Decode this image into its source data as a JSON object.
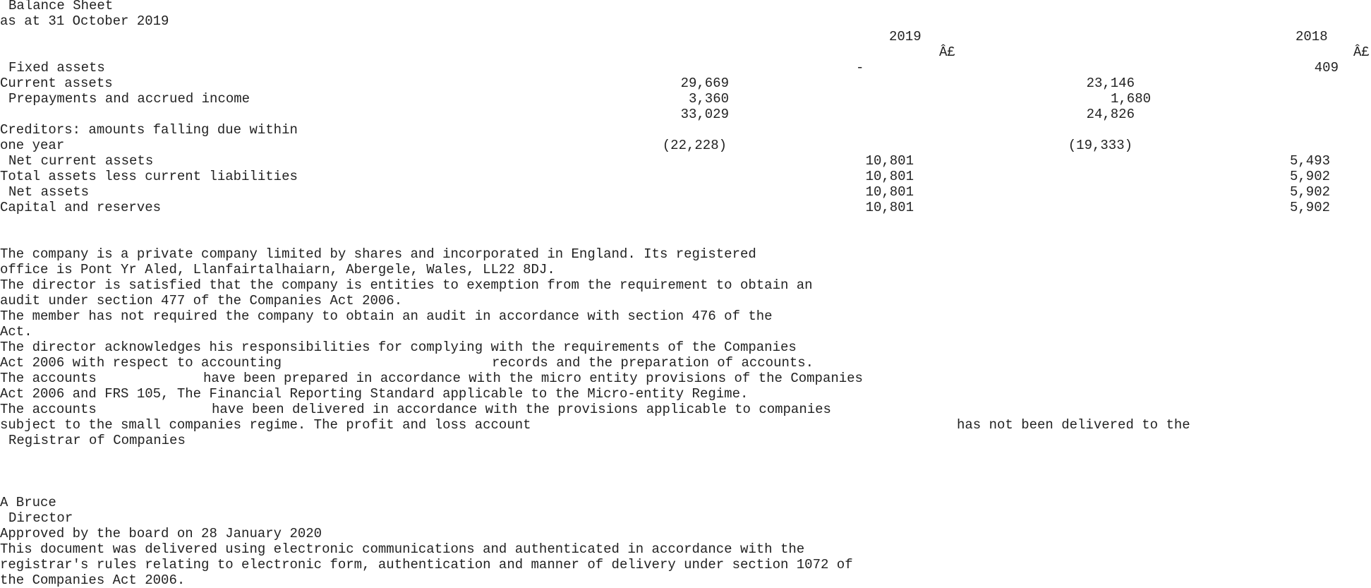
{
  "header": {
    "title": "Balance Sheet",
    "date_line": "as at 31 October 2019"
  },
  "columns": {
    "year_current": "2019",
    "year_prior": "2018",
    "currency_current": "Â£",
    "currency_prior": "Â£"
  },
  "balance_sheet": {
    "fixed_assets": {
      "label": "Fixed assets",
      "current_total": "-",
      "prior_total": "409"
    },
    "current_assets": {
      "label": "Current assets",
      "current_sub": "29,669",
      "prior_sub": "23,146"
    },
    "prepayments": {
      "label": "Prepayments and accrued income",
      "current_sub": "3,360",
      "prior_sub": "1,680"
    },
    "current_subtotal": {
      "current_sub": "33,029",
      "prior_sub": "24,826"
    },
    "creditors": {
      "label_line1": "Creditors: amounts falling due within",
      "label_line2": "one year",
      "current_sub": "(22,228)",
      "prior_sub": "(19,333)"
    },
    "net_current_assets": {
      "label": "Net current assets",
      "current_total": "10,801",
      "prior_total": "5,493"
    },
    "total_assets_less_cl": {
      "label": "Total assets less current liabilities",
      "current_total": "10,801",
      "prior_total": "5,902"
    },
    "net_assets": {
      "label": "Net assets",
      "current_total": "10,801",
      "prior_total": "5,902"
    },
    "capital_reserves": {
      "label": "Capital and reserves",
      "current_total": "10,801",
      "prior_total": "5,902"
    }
  },
  "notes": {
    "company_1": "The company is a private company limited by shares and incorporated in England. Its registered",
    "company_2": "office is Pont Yr Aled, Llanfairtalhaiarn, Abergele, Wales, LL22 8DJ.",
    "exemption_1": "The director is satisfied that the company is entities to exemption from the requirement to obtain an",
    "exemption_2": "audit under section 477 of the Companies Act 2006.",
    "member_1": "The member has not required the company to obtain an audit in accordance with section 476 of the",
    "member_2": "Act.",
    "resp_1": "The director acknowledges his responsibilities for complying with the requirements of the Companies",
    "resp_2a": "Act 2006 with respect to accounting",
    "resp_2b": "records and the preparation of accounts.",
    "prepared_1a": "The accounts",
    "prepared_1b": "have been prepared in accordance with the micro entity provisions of the Companies",
    "prepared_2": "Act 2006 and FRS 105, The Financial Reporting Standard applicable to the Micro-entity Regime.",
    "delivered_1a": "The accounts",
    "delivered_1b": "have been delivered in accordance with the provisions applicable to companies",
    "delivered_2a": "subject to the small companies regime. The profit and loss account",
    "delivered_2b": "has not been delivered to the",
    "delivered_3": "Registrar of Companies"
  },
  "signature": {
    "name": "A Bruce",
    "role": "Director",
    "approved": "Approved by the board on 28 January 2020"
  },
  "footer": {
    "line1": "This document was delivered using electronic communications and authenticated in accordance with the",
    "line2": "registrar's rules relating to electronic form, authentication and manner of delivery under section 1072 of",
    "line3": "the Companies Act 2006."
  }
}
